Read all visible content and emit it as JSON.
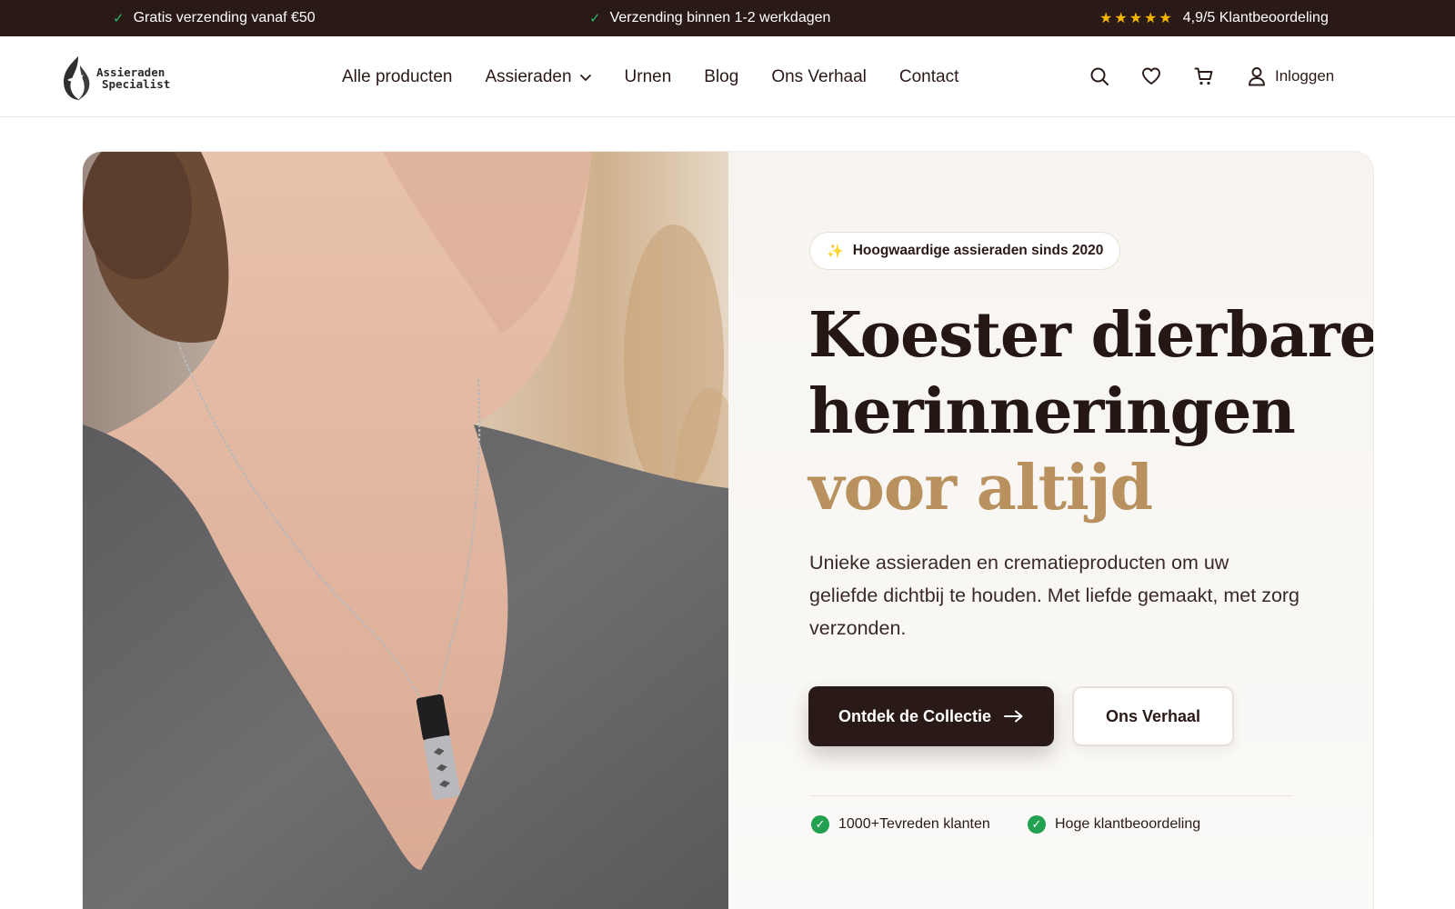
{
  "topbar": {
    "items": [
      {
        "icon": "check-icon",
        "text": "Gratis verzending vanaf €50"
      },
      {
        "icon": "check-icon",
        "text": "Verzending binnen 1-2 werkdagen"
      },
      {
        "icon": "star-icon",
        "text": "4,9/5 Klantbeoordeling",
        "stars": "★★★★★"
      }
    ],
    "colors": {
      "background": "#2a1a17",
      "check": "#2fb36a",
      "star": "#f4b400"
    }
  },
  "header": {
    "logo": {
      "line1": "Assieraden",
      "line2": "Specialist"
    },
    "nav": [
      {
        "label": "Alle producten"
      },
      {
        "label": "Assieraden",
        "dropdown": true
      },
      {
        "label": "Urnen"
      },
      {
        "label": "Blog"
      },
      {
        "label": "Ons Verhaal"
      },
      {
        "label": "Contact"
      }
    ],
    "actions": {
      "search_icon": "search-icon",
      "wishlist_icon": "heart-icon",
      "cart_icon": "cart-icon",
      "login_label": "Inloggen"
    }
  },
  "hero": {
    "badge": {
      "icon": "sparkle-icon",
      "text": "Hoogwaardige assieraden sinds 2020"
    },
    "headline": {
      "line1": "Koester dierbare",
      "line2": "herinneringen",
      "accent": "voor altijd"
    },
    "subtitle": "Unieke assieraden en crematieproducten om uw geliefde dichtbij te houden. Met liefde gemaakt, met zorg verzonden.",
    "primary_button": "Ontdek de Collectie",
    "secondary_button": "Ons Verhaal",
    "trust": [
      {
        "icon": "check-circle-icon",
        "text": "1000+Tevreden klanten"
      },
      {
        "icon": "check-circle-icon",
        "text": "Hoge klantbeoordeling"
      }
    ],
    "image": {
      "description_icon": "necklace-photo"
    },
    "colors": {
      "accent": "#b8915f",
      "dark": "#2a1a17",
      "trust": "#22a150"
    }
  }
}
